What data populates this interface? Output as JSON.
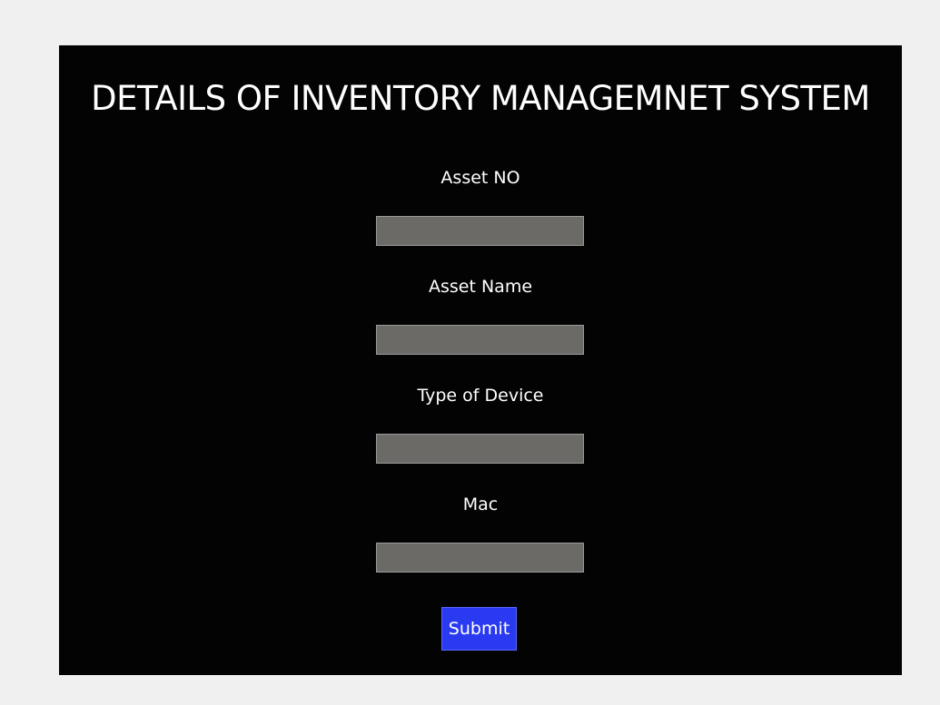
{
  "form": {
    "title": "DETAILS OF INVENTORY MANAGEMNET SYSTEM",
    "fields": [
      {
        "label": "Asset NO",
        "value": "",
        "placeholder": ""
      },
      {
        "label": "Asset Name",
        "value": "",
        "placeholder": ""
      },
      {
        "label": "Type of Device",
        "value": "",
        "placeholder": ""
      },
      {
        "label": "Mac",
        "value": "",
        "placeholder": ""
      }
    ],
    "submit_label": "Submit"
  },
  "colors": {
    "page_background": "#f0f0f0",
    "panel_background": "#030303",
    "input_background": "#6b6a67",
    "submit_background": "#2a3af0",
    "text": "#ffffff"
  }
}
